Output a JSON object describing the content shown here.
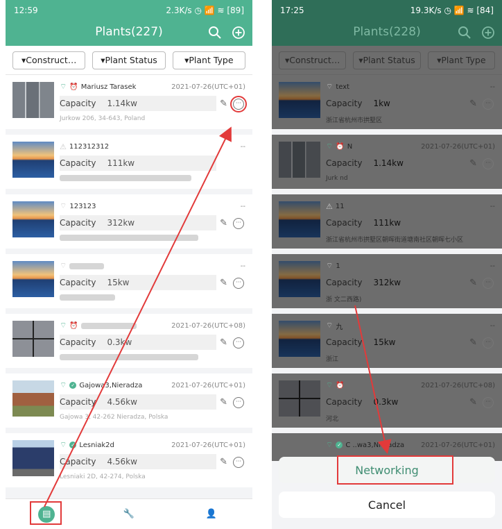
{
  "left": {
    "status": {
      "time": "12:59",
      "right": "2.3K/s ◷ 📶 ≋ [89]"
    },
    "title": "Plants(227)",
    "filters": [
      "Construct…",
      "Plant Status",
      "Plant Type"
    ],
    "cap_label": "Capacity",
    "items": [
      {
        "name": "Mariusz Tarasek",
        "date": "2021-07-26(UTC+01)",
        "value": "1.14kw",
        "addr": "Jurkow 206, 34-643, Poland"
      },
      {
        "name": "112312312",
        "date": "--",
        "value": "111kw",
        "addr": ""
      },
      {
        "name": "123123",
        "date": "--",
        "value": "312kw",
        "addr": ""
      },
      {
        "name": "",
        "date": "--",
        "value": "15kw",
        "addr": ""
      },
      {
        "name": "",
        "date": "2021-07-26(UTC+08)",
        "value": "0.3kw",
        "addr": ""
      },
      {
        "name": "Gajowa3,Nieradza",
        "date": "2021-07-26(UTC+01)",
        "value": "4.56kw",
        "addr": "Gajowa 3, 42-262 Nieradza, Polska"
      },
      {
        "name": "Lesniak2d",
        "date": "2021-07-26(UTC+01)",
        "value": "4.56kw",
        "addr": "Lesniaki 2D, 42-274, Polska"
      }
    ]
  },
  "right": {
    "status": {
      "time": "17:25",
      "right": "19.3K/s ◷ 📶 ≋ [84]"
    },
    "title": "Plants(228)",
    "filters": [
      "Construct…",
      "Plant Status",
      "Plant Type"
    ],
    "cap_label": "Capacity",
    "items": [
      {
        "name": "text",
        "date": "--",
        "value": "1kw",
        "addr": "浙江省杭州市拱墅区"
      },
      {
        "name": "N",
        "date": "2021-07-26(UTC+01)",
        "value": "1.14kw",
        "addr": "Jurk                nd"
      },
      {
        "name": "11",
        "date": "--",
        "value": "111kw",
        "addr": "浙江省杭州市拱墅区朝晖街道塘南社区朝晖七小区"
      },
      {
        "name": "1",
        "date": "--",
        "value": "312kw",
        "addr": "浙                            文二西路)"
      },
      {
        "name": "九",
        "date": "--",
        "value": "15kw",
        "addr": "浙江"
      },
      {
        "name": "",
        "date": "2021-07-26(UTC+08)",
        "value": "0.3kw",
        "addr": "河北"
      }
    ],
    "partial": {
      "name": "C   ..wa3,Nieradza",
      "date": "2021-07-26(UTC+01)"
    },
    "networking": "Networking",
    "cancel": "Cancel"
  }
}
